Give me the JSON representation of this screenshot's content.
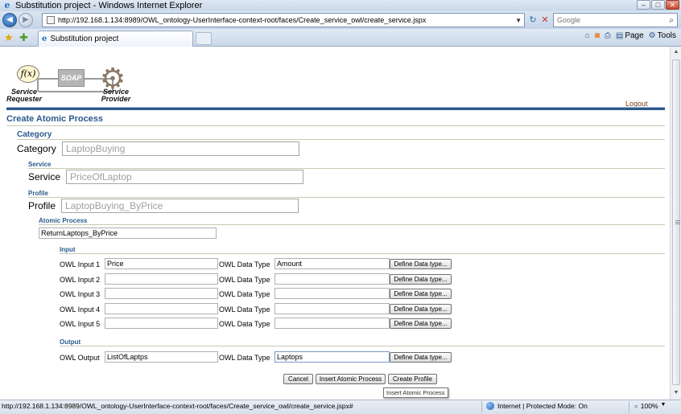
{
  "window": {
    "title": "Substitution project - Windows Internet Explorer",
    "minimize": "–",
    "maximize": "□",
    "close": "✕"
  },
  "nav": {
    "back": "◀",
    "forward": "▶",
    "address": "http://192.168.1.134:8989/OWL_ontology-UserInterface-context-root/faces/Create_service_owl/create_service.jspx",
    "search_placeholder": "Google"
  },
  "tabs": [
    {
      "label": "Substitution project"
    }
  ],
  "command_bar": {
    "page": "Page",
    "tools": "Tools"
  },
  "header": {
    "logo": {
      "fx": "f(x)",
      "soap": "SOAP",
      "requester_line1": "Service",
      "requester_line2": "Requester",
      "provider_line1": "Service",
      "provider_line2": "Provider"
    },
    "logout": "Logout"
  },
  "page": {
    "title": "Create Atomic Process",
    "category": {
      "section": "Category",
      "label": "Category",
      "value": "LaptopBuying"
    },
    "service": {
      "section": "Service",
      "label": "Service",
      "value": "PriceOfLaptop"
    },
    "profile": {
      "section": "Profile",
      "label": "Profile",
      "value": "LaptopBuying_ByPrice"
    },
    "atomic_process": {
      "section": "Atomic Process",
      "value": "ReturnLaptops_ByPrice"
    },
    "input": {
      "section": "Input",
      "rows": [
        {
          "label": "OWL Input 1",
          "value": "Price",
          "type_label": "OWL Data Type",
          "type_value": "Amount",
          "button": "Define Data type..."
        },
        {
          "label": "OWL Input 2",
          "value": "",
          "type_label": "OWL Data Type",
          "type_value": "",
          "button": "Define Data type..."
        },
        {
          "label": "OWL Input 3",
          "value": "",
          "type_label": "OWL Data Type",
          "type_value": "",
          "button": "Define Data type..."
        },
        {
          "label": "OWL Input 4",
          "value": "",
          "type_label": "OWL Data Type",
          "type_value": "",
          "button": "Define Data type..."
        },
        {
          "label": "OWL Input 5",
          "value": "",
          "type_label": "OWL Data Type",
          "type_value": "",
          "button": "Define Data type..."
        }
      ]
    },
    "output": {
      "section": "Output",
      "label": "OWL Output",
      "value": "ListOfLaptps",
      "type_label": "OWL Data Type",
      "type_value": "Laptops",
      "button": "Define Data type..."
    },
    "actions": {
      "cancel": "Cancel",
      "insert": "Insert Atomic Process",
      "create_profile": "Create Profile"
    },
    "tooltip": "Insert Atomic Process"
  },
  "status": {
    "url": "http://192.168.1.134:8989/OWL_ontology-UserInterface-context-root/faces/Create_service_owl/create_service.jspx#",
    "zone": "Internet | Protected Mode: On",
    "zoom": "100%"
  }
}
